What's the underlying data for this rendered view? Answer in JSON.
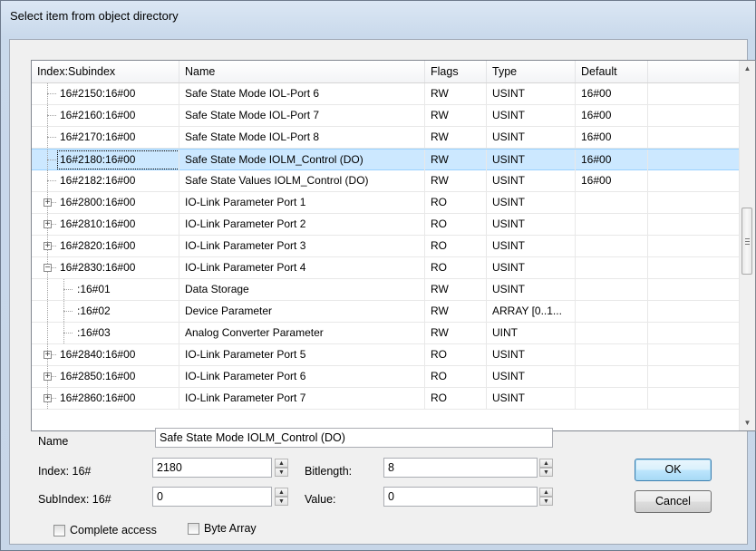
{
  "window": {
    "title": "Select item from object directory"
  },
  "columns": [
    "Index:Subindex",
    "Name",
    "Flags",
    "Type",
    "Default"
  ],
  "rows": [
    {
      "index": "16#2150:16#00",
      "name": "Safe State Mode IOL-Port 6",
      "flags": "RW",
      "type": "USINT",
      "default": "16#00",
      "level": 1,
      "expander": ""
    },
    {
      "index": "16#2160:16#00",
      "name": "Safe State Mode IOL-Port 7",
      "flags": "RW",
      "type": "USINT",
      "default": "16#00",
      "level": 1,
      "expander": ""
    },
    {
      "index": "16#2170:16#00",
      "name": "Safe State Mode IOL-Port 8",
      "flags": "RW",
      "type": "USINT",
      "default": "16#00",
      "level": 1,
      "expander": ""
    },
    {
      "index": "16#2180:16#00",
      "name": "Safe State Mode IOLM_Control (DO)",
      "flags": "RW",
      "type": "USINT",
      "default": "16#00",
      "level": 1,
      "expander": "",
      "selected": true
    },
    {
      "index": "16#2182:16#00",
      "name": "Safe State Values IOLM_Control (DO)",
      "flags": "RW",
      "type": "USINT",
      "default": "16#00",
      "level": 1,
      "expander": ""
    },
    {
      "index": "16#2800:16#00",
      "name": "IO-Link Parameter Port 1",
      "flags": "RO",
      "type": "USINT",
      "default": "",
      "level": 1,
      "expander": "+"
    },
    {
      "index": "16#2810:16#00",
      "name": "IO-Link Parameter Port 2",
      "flags": "RO",
      "type": "USINT",
      "default": "",
      "level": 1,
      "expander": "+"
    },
    {
      "index": "16#2820:16#00",
      "name": "IO-Link Parameter Port 3",
      "flags": "RO",
      "type": "USINT",
      "default": "",
      "level": 1,
      "expander": "+"
    },
    {
      "index": "16#2830:16#00",
      "name": "IO-Link Parameter Port 4",
      "flags": "RO",
      "type": "USINT",
      "default": "",
      "level": 1,
      "expander": "−"
    },
    {
      "index": ":16#01",
      "name": "Data Storage",
      "flags": "RW",
      "type": "USINT",
      "default": "",
      "level": 2,
      "expander": ""
    },
    {
      "index": ":16#02",
      "name": "Device Parameter",
      "flags": "RW",
      "type": "ARRAY [0..1...",
      "default": "",
      "level": 2,
      "expander": ""
    },
    {
      "index": ":16#03",
      "name": "Analog Converter Parameter",
      "flags": "RW",
      "type": "UINT",
      "default": "",
      "level": 2,
      "expander": ""
    },
    {
      "index": "16#2840:16#00",
      "name": "IO-Link Parameter Port 5",
      "flags": "RO",
      "type": "USINT",
      "default": "",
      "level": 1,
      "expander": "+"
    },
    {
      "index": "16#2850:16#00",
      "name": "IO-Link Parameter Port 6",
      "flags": "RO",
      "type": "USINT",
      "default": "",
      "level": 1,
      "expander": "+"
    },
    {
      "index": "16#2860:16#00",
      "name": "IO-Link Parameter Port 7",
      "flags": "RO",
      "type": "USINT",
      "default": "",
      "level": 1,
      "expander": "+"
    }
  ],
  "form": {
    "name_label": "Name",
    "name_value": "Safe State Mode IOLM_Control (DO)",
    "index_label": "Index: 16#",
    "index_value": "2180",
    "bitlength_label": "Bitlength:",
    "bitlength_value": "8",
    "subindex_label": "SubIndex: 16#",
    "subindex_value": "0",
    "value_label": "Value:",
    "value_value": "0",
    "complete_access_label": "Complete access",
    "byte_array_label": "Byte Array",
    "complete_access_checked": false,
    "byte_array_checked": false
  },
  "buttons": {
    "ok": "OK",
    "cancel": "Cancel"
  },
  "colors": {
    "selection": "#cce8ff",
    "selection_border": "#99d1ff",
    "default_button_border": "#3c7fb1"
  }
}
